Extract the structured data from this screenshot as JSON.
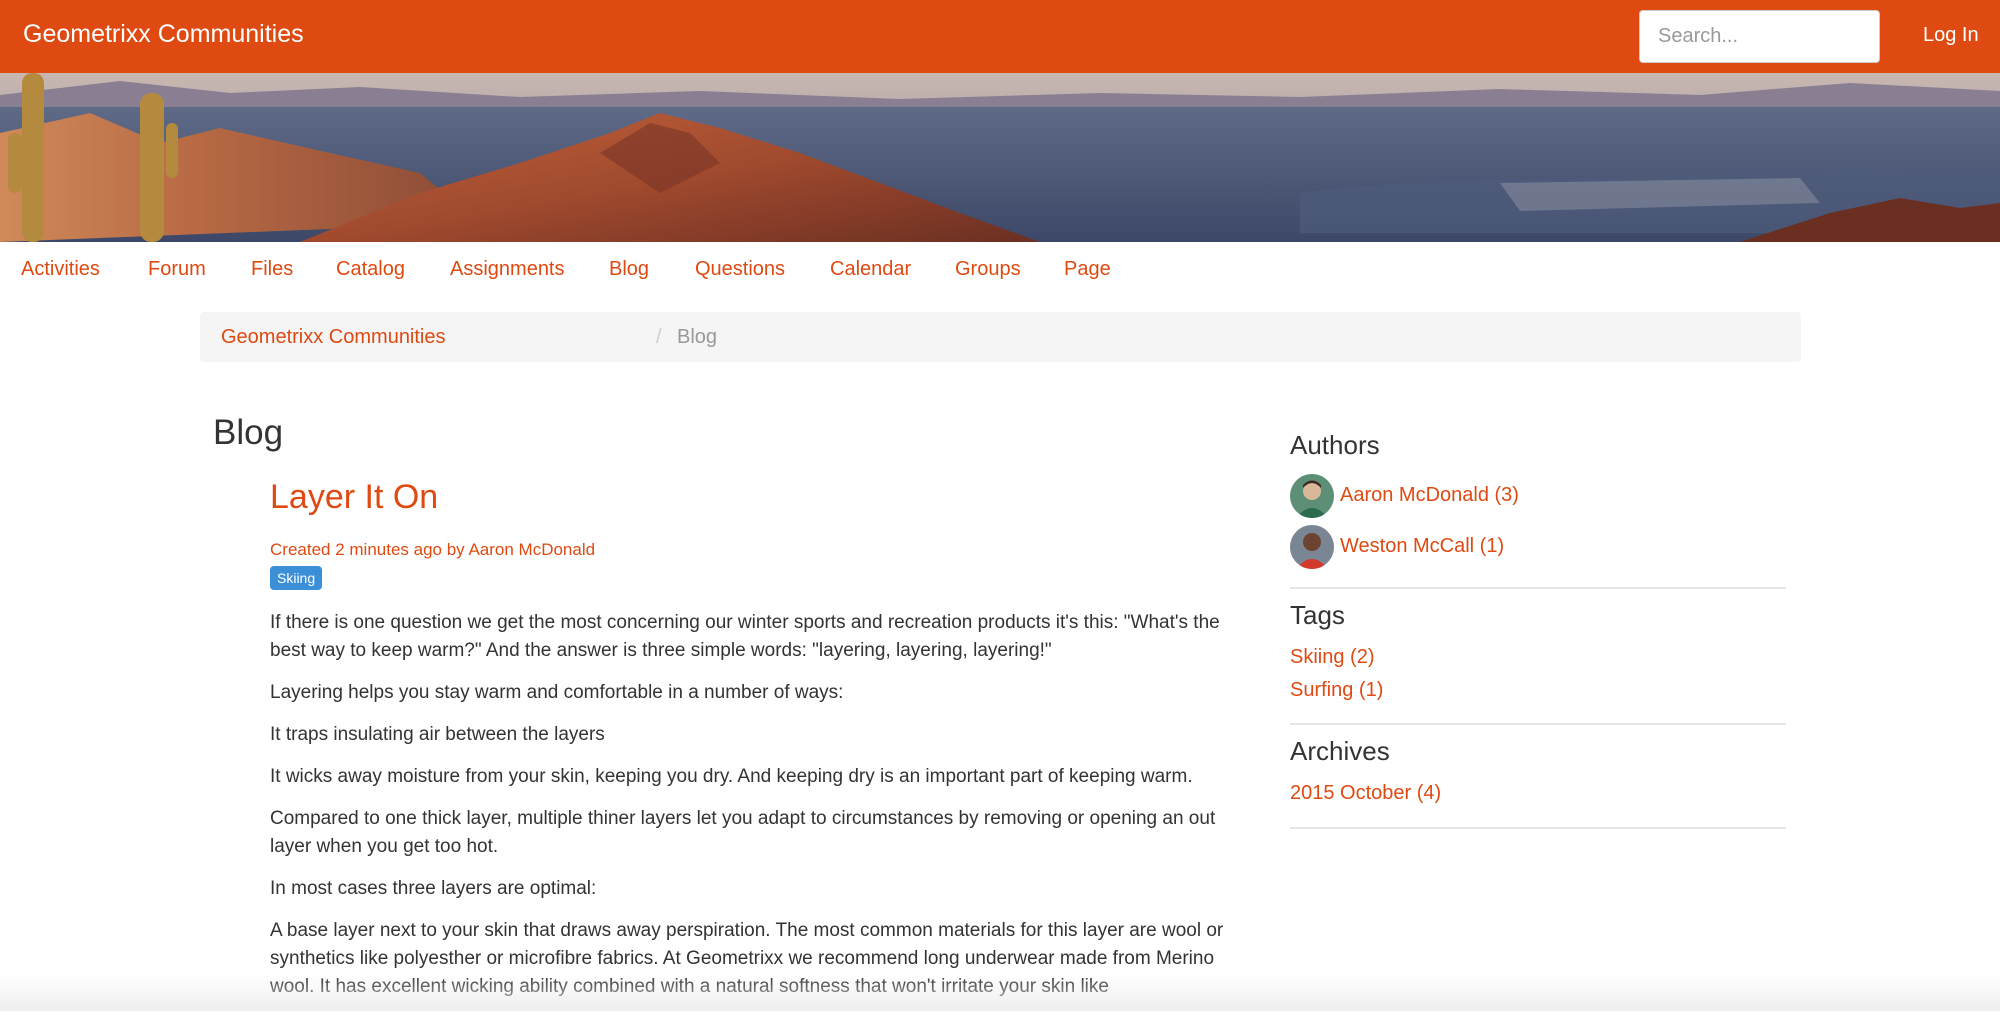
{
  "header": {
    "brand": "Geometrixx Communities",
    "search_placeholder": "Search...",
    "login_label": "Log In",
    "accent_color": "#de4a12"
  },
  "banner": {
    "image_description": "desert mountain landscape with saguaro cacti overlooking a city valley"
  },
  "nav": {
    "items": [
      "Activities",
      "Forum",
      "Files",
      "Catalog",
      "Assignments",
      "Blog",
      "Questions",
      "Calendar",
      "Groups",
      "Page"
    ]
  },
  "breadcrumb": {
    "home": "Geometrixx Communities",
    "separator": "/",
    "current": "Blog"
  },
  "main": {
    "page_title": "Blog",
    "post": {
      "title": "Layer It On",
      "meta": "Created 2 minutes ago by Aaron McDonald",
      "tag": "Skiing",
      "tag_color": "#3b8fd6",
      "paragraphs": [
        "If there is one question we get the most concerning our winter sports and recreation products it's this: \"What's the best way to keep warm?\" And the answer is three simple words: \"layering, layering, layering!\"",
        "Layering helps you stay warm and comfortable in a number of ways:",
        "It traps insulating air between the layers",
        "It wicks away moisture from your skin, keeping you dry. And keeping dry is an important part of keeping warm.",
        "Compared to one thick layer, multiple thiner layers let you adapt to circumstances by removing or opening an out layer when you get too hot.",
        "In most cases three layers are optimal:",
        "A base layer next to your skin that draws away perspiration. The most common materials for this layer are wool or synthetics like polyesther or microfibre fabrics. At Geometrixx we recommend long underwear made from Merino wool. It has excellent wicking ability combined with a natural softness that won't irritate your skin like"
      ]
    }
  },
  "sidebar": {
    "authors_heading": "Authors",
    "authors": [
      {
        "name": "Aaron McDonald (3)",
        "avatar_icon": "avatar-aaron-icon"
      },
      {
        "name": "Weston McCall (1)",
        "avatar_icon": "avatar-weston-icon"
      }
    ],
    "tags_heading": "Tags",
    "tags": [
      "Skiing (2)",
      "Surfing (1)"
    ],
    "archives_heading": "Archives",
    "archives": [
      "2015 October (4)"
    ]
  }
}
